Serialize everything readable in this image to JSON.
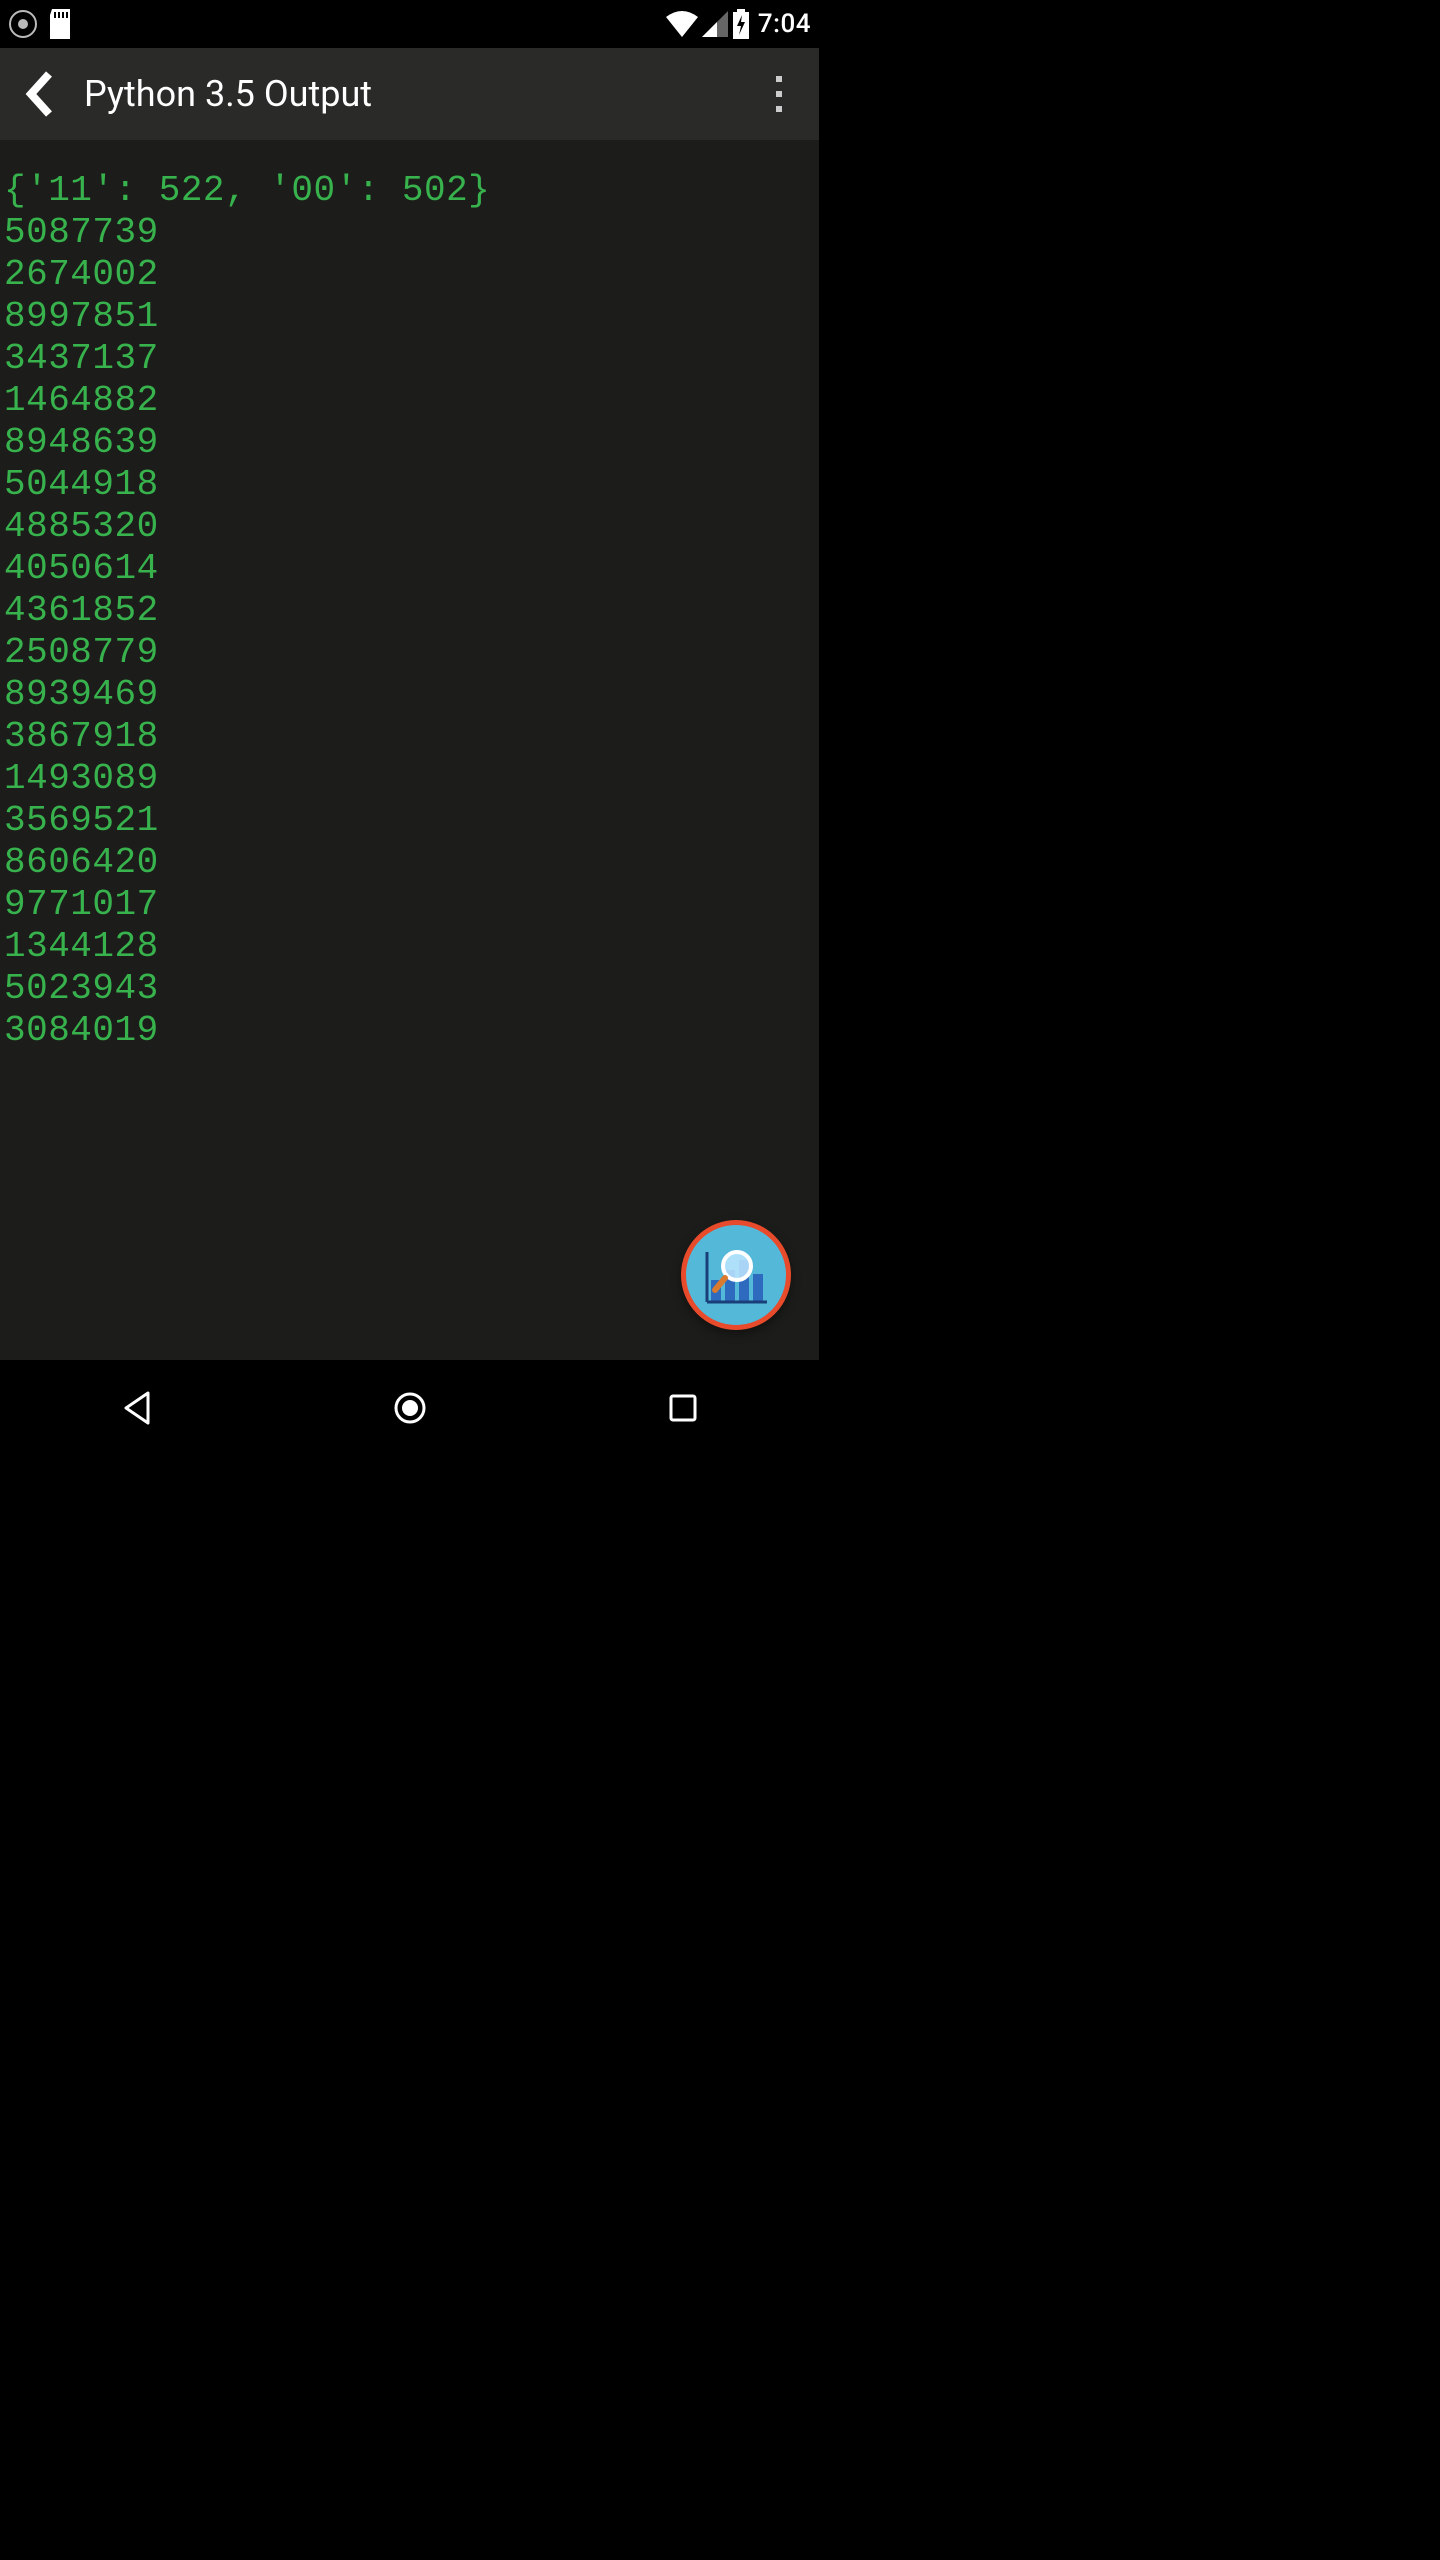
{
  "status_bar": {
    "time": "7:04"
  },
  "toolbar": {
    "title": "Python 3.5 Output"
  },
  "output": {
    "lines": [
      "{'11': 522, '00': 502}",
      "5087739",
      "2674002",
      "8997851",
      "3437137",
      "1464882",
      "8948639",
      "5044918",
      "4885320",
      "4050614",
      "4361852",
      "2508779",
      "8939469",
      "3867918",
      "1493089",
      "3569521",
      "8606420",
      "9771017",
      "1344128",
      "5023943",
      "3084019"
    ]
  },
  "colors": {
    "terminal_bg": "#1c1d1a",
    "terminal_fg": "#37b24d",
    "toolbar_bg": "#2a2a28",
    "fab_bg": "#54b8d9",
    "fab_border": "#e84b2c"
  },
  "icons": {
    "back": "back-arrow-icon",
    "overflow": "overflow-menu-icon",
    "fab": "chart-magnify-icon"
  }
}
